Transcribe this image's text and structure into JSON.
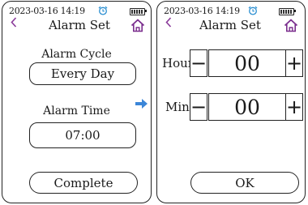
{
  "left_screen": {
    "status": {
      "time": "2023-03-16 14:19"
    },
    "header": {
      "title": "Alarm Set"
    },
    "alarm_cycle": {
      "label": "Alarm Cycle",
      "value": "Every Day"
    },
    "alarm_time": {
      "label": "Alarm Time",
      "value": "07:00"
    },
    "complete_button": {
      "label": "Complete"
    }
  },
  "right_screen": {
    "status": {
      "time": "2023-03-16 14:19"
    },
    "header": {
      "title": "Alarm Set"
    },
    "hour": {
      "label": "Hour",
      "value": "00",
      "minus": "−",
      "plus": "+"
    },
    "min": {
      "label": "Min",
      "value": "00",
      "minus": "−",
      "plus": "+"
    },
    "ok_button": {
      "label": "OK"
    }
  },
  "colors": {
    "accent_back": "#8a3a9a",
    "accent_home": "#7a2e8e",
    "alarm_icon": "#2b8fd1",
    "arrow_icon": "#3b86d8"
  },
  "icons": [
    "alarm-clock-icon",
    "battery-icon",
    "back-chevron-icon",
    "home-icon",
    "right-arrow-icon"
  ]
}
